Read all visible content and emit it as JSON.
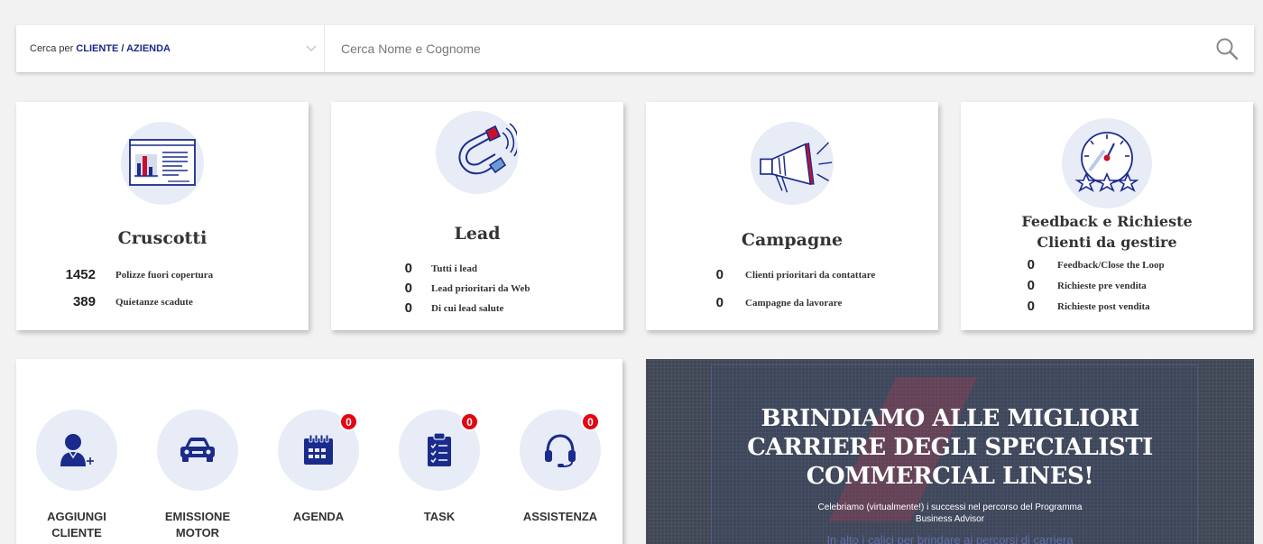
{
  "search": {
    "select_prefix": "Cerca per",
    "select_value": "CLIENTE / AZIENDA",
    "placeholder": "Cerca Nome e Cognome"
  },
  "cards": {
    "cruscotti": {
      "title": "Cruscotti",
      "stats": [
        {
          "value": "1452",
          "label": "Polizze fuori copertura"
        },
        {
          "value": "389",
          "label": "Quietanze scadute"
        }
      ]
    },
    "lead": {
      "title": "Lead",
      "stats": [
        {
          "value": "0",
          "label": "Tutti i lead"
        },
        {
          "value": "0",
          "label": "Lead prioritari da Web"
        },
        {
          "value": "0",
          "label": "Di cui lead salute"
        }
      ]
    },
    "campagne": {
      "title": "Campagne",
      "stats": [
        {
          "value": "0",
          "label": "Clienti prioritari da contattare"
        },
        {
          "value": "0",
          "label": "Campagne da lavorare"
        }
      ]
    },
    "feedback": {
      "title_line1": "Feedback e Richieste",
      "title_line2": "Clienti da gestire",
      "stats": [
        {
          "value": "0",
          "label": "Feedback/Close the Loop"
        },
        {
          "value": "0",
          "label": "Richieste pre vendita"
        },
        {
          "value": "0",
          "label": "Richieste post vendita"
        }
      ]
    }
  },
  "actions": [
    {
      "label_line1": "AGGIUNGI",
      "label_line2": "CLIENTE",
      "icon": "add-user-icon"
    },
    {
      "label_line1": "EMISSIONE",
      "label_line2": "MOTOR",
      "icon": "car-icon"
    },
    {
      "label_line1": "AGENDA",
      "label_line2": "",
      "icon": "calendar-icon",
      "badge": "0"
    },
    {
      "label_line1": "TASK",
      "label_line2": "",
      "icon": "clipboard-icon",
      "badge": "0"
    },
    {
      "label_line1": "ASSISTENZA",
      "label_line2": "",
      "icon": "headset-icon",
      "badge": "0"
    }
  ],
  "banner": {
    "title_line1": "BRINDIAMO ALLE MIGLIORI",
    "title_line2": "CARRIERE DEGLI SPECIALISTI",
    "title_line3": "COMMERCIAL LINES!",
    "subtitle_line1": "Celebriamo (virtualmente!) i successi nel percorso del Programma",
    "subtitle_line2": "Business Advisor",
    "faded_text": "In alto i calici per brindare ai percorsi di carriera"
  },
  "colors": {
    "accent_navy": "#1a2b8c",
    "icon_circle": "#e7ecf7",
    "badge_red": "#e30613",
    "banner_bg": "#3f4654"
  }
}
